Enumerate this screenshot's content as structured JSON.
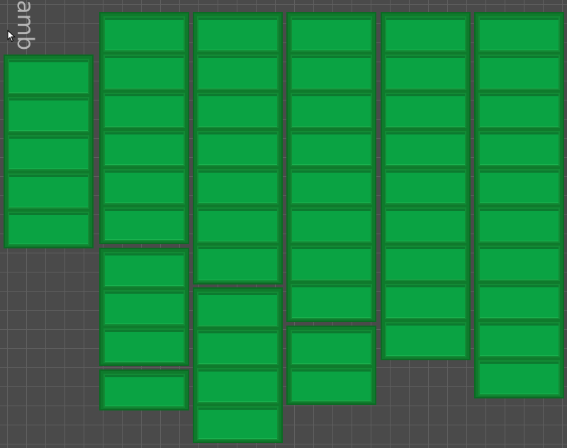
{
  "plate_label": "amb  l Plate",
  "icons": {
    "cursor": "mouse-pointer-icon"
  },
  "colors": {
    "background": "#4a4a4a",
    "grid_line": "#5f5f5f",
    "object_fill": "#0aa343",
    "object_border": "#0b6a23",
    "label": "#b5b5b5"
  }
}
